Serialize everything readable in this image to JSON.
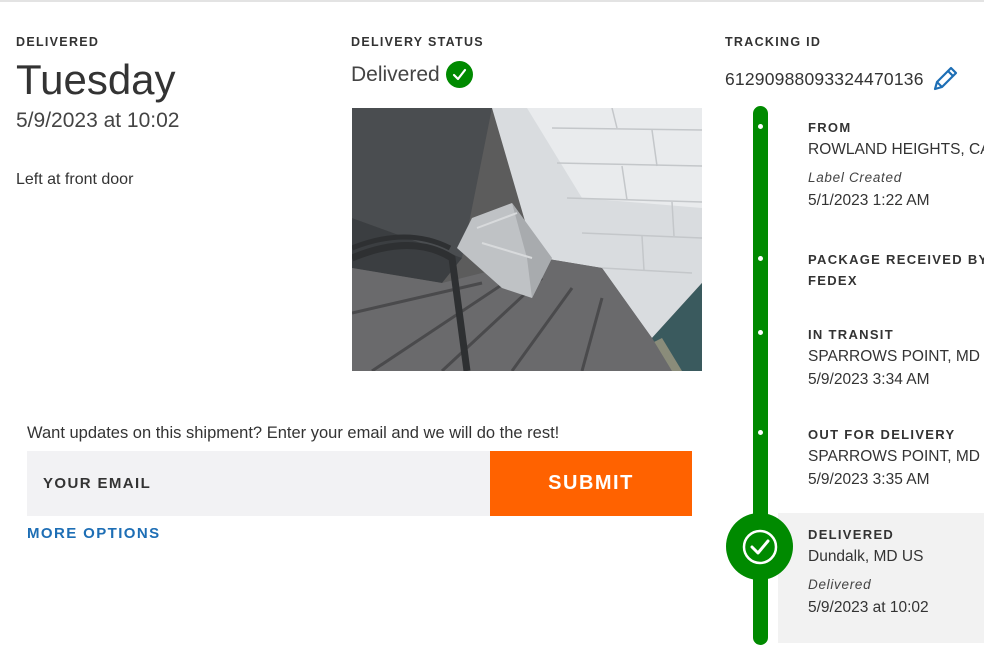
{
  "delivered_block": {
    "heading": "DELIVERED",
    "day": "Tuesday",
    "datetime": "5/9/2023 at 10:02",
    "note": "Left at front door"
  },
  "status_block": {
    "heading": "DELIVERY STATUS",
    "status": "Delivered",
    "icon": "check-circle-icon"
  },
  "tracking_block": {
    "heading": "TRACKING ID",
    "number": "612909880933244701​36",
    "edit_icon": "pencil-icon"
  },
  "updates": {
    "prompt": "Want updates on this shipment? Enter your email and we will do the rest!",
    "email_placeholder": "YOUR EMAIL",
    "submit_label": "SUBMIT",
    "more_options": "MORE OPTIONS"
  },
  "timeline": {
    "events": [
      {
        "title": "FROM",
        "line1": "ROWLAND HEIGHTS, CA",
        "status_italic": "Label Created",
        "time": "5/1/2023 1:22 AM"
      },
      {
        "title_line1": "PACKAGE RECEIVED BY",
        "title_line2": "FEDEX"
      },
      {
        "title": "IN TRANSIT",
        "line1": "SPARROWS POINT, MD",
        "time": "5/9/2023 3:34 AM"
      },
      {
        "title": "OUT FOR DELIVERY",
        "line1": "SPARROWS POINT, MD",
        "time": "5/9/2023 3:35 AM"
      },
      {
        "title": "DELIVERED",
        "line1": "Dundalk, MD US",
        "status_italic": "Delivered",
        "time": "5/9/2023 at 10:02"
      }
    ]
  },
  "colors": {
    "brand_orange": "#ff6200",
    "success_green": "#008a00",
    "link_blue": "#1d6eb5"
  }
}
